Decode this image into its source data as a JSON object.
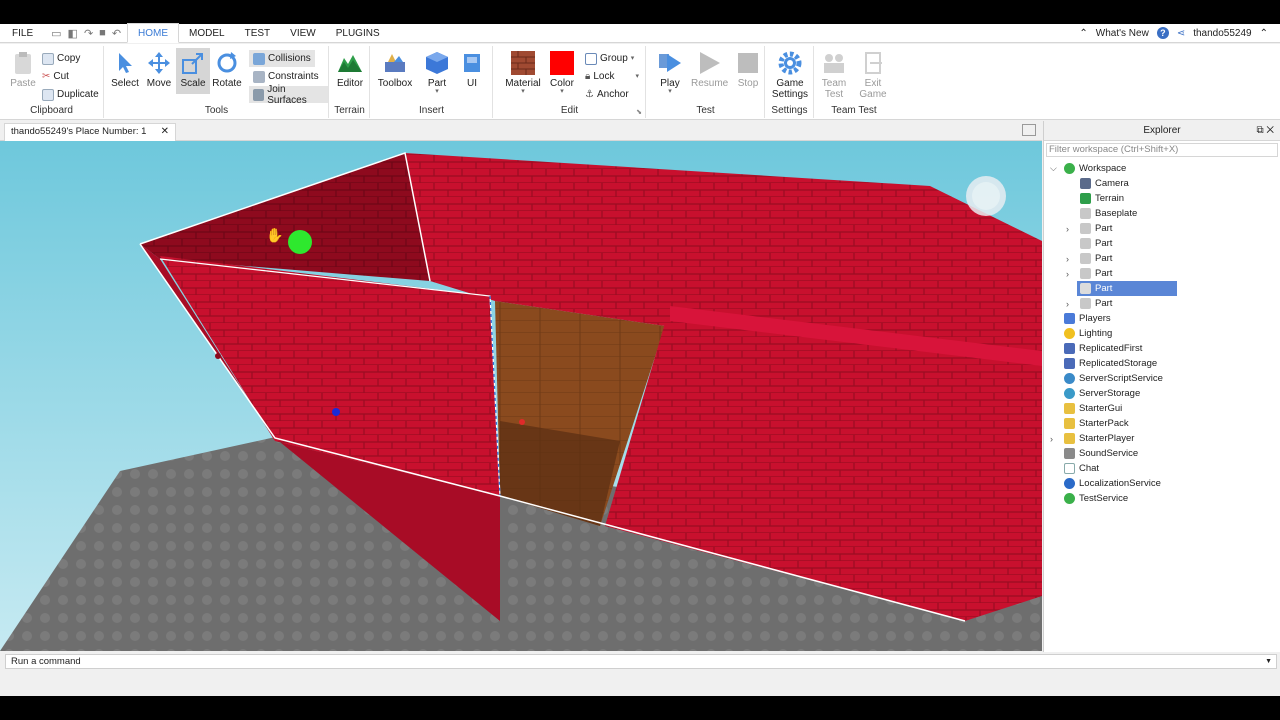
{
  "menubar": {
    "tabs": [
      "FILE",
      "HOME",
      "MODEL",
      "TEST",
      "VIEW",
      "PLUGINS"
    ],
    "active_tab": "HOME",
    "whats_new": "What's New",
    "username": "thando55249"
  },
  "ribbon": {
    "clipboard": {
      "label": "Clipboard",
      "paste": "Paste",
      "copy": "Copy",
      "cut": "Cut",
      "duplicate": "Duplicate"
    },
    "tools": {
      "label": "Tools",
      "select": "Select",
      "move": "Move",
      "scale": "Scale",
      "rotate": "Rotate",
      "collisions": "Collisions",
      "constraints": "Constraints",
      "join_surfaces": "Join Surfaces"
    },
    "terrain": {
      "label": "Terrain",
      "editor": "Editor"
    },
    "insert": {
      "label": "Insert",
      "toolbox": "Toolbox",
      "part": "Part",
      "ui": "UI"
    },
    "edit": {
      "label": "Edit",
      "material": "Material",
      "color": "Color",
      "group": "Group",
      "lock": "Lock",
      "anchor": "Anchor"
    },
    "test": {
      "label": "Test",
      "play": "Play",
      "resume": "Resume",
      "stop": "Stop"
    },
    "settings": {
      "label": "Settings",
      "game_settings_1": "Game",
      "game_settings_2": "Settings"
    },
    "team_test": {
      "label": "Team Test",
      "team_test_1": "Team",
      "team_test_2": "Test",
      "exit_game_1": "Exit",
      "exit_game_2": "Game"
    }
  },
  "document": {
    "tab_title": "thando55249's Place Number: 1"
  },
  "explorer": {
    "title": "Explorer",
    "filter_placeholder": "Filter workspace (Ctrl+Shift+X)",
    "items": [
      {
        "label": "Workspace",
        "icon": "workspace-icon"
      },
      {
        "label": "Camera",
        "icon": "camera-icon"
      },
      {
        "label": "Terrain",
        "icon": "terrain-icon"
      },
      {
        "label": "Baseplate",
        "icon": "part-icon"
      },
      {
        "label": "Part",
        "icon": "part-icon"
      },
      {
        "label": "Part",
        "icon": "part-icon"
      },
      {
        "label": "Part",
        "icon": "part-icon"
      },
      {
        "label": "Part",
        "icon": "part-icon"
      },
      {
        "label": "Part",
        "icon": "part-icon",
        "selected": true
      },
      {
        "label": "Part",
        "icon": "part-icon"
      },
      {
        "label": "Players",
        "icon": "players-icon"
      },
      {
        "label": "Lighting",
        "icon": "lighting-icon"
      },
      {
        "label": "ReplicatedFirst",
        "icon": "replicated-first-icon"
      },
      {
        "label": "ReplicatedStorage",
        "icon": "replicated-storage-icon"
      },
      {
        "label": "ServerScriptService",
        "icon": "server-script-service-icon"
      },
      {
        "label": "ServerStorage",
        "icon": "server-storage-icon"
      },
      {
        "label": "StarterGui",
        "icon": "starter-gui-icon"
      },
      {
        "label": "StarterPack",
        "icon": "starter-pack-icon"
      },
      {
        "label": "StarterPlayer",
        "icon": "starter-player-icon"
      },
      {
        "label": "SoundService",
        "icon": "sound-service-icon"
      },
      {
        "label": "Chat",
        "icon": "chat-icon"
      },
      {
        "label": "LocalizationService",
        "icon": "localization-service-icon"
      },
      {
        "label": "TestService",
        "icon": "test-service-icon"
      }
    ]
  },
  "command_bar": {
    "placeholder": "Run a command"
  }
}
